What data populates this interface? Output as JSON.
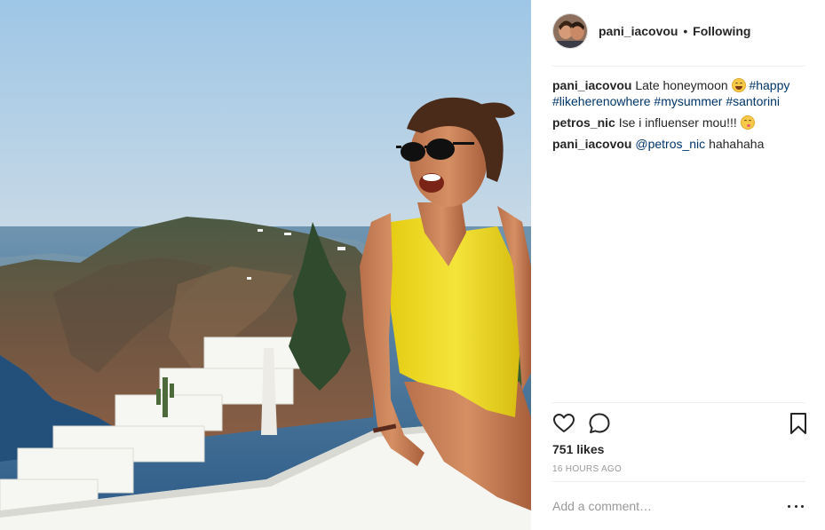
{
  "post": {
    "photo_alt": "Woman in yellow swimsuit and sunglasses sitting on a white wall above the Santorini caldera",
    "author": {
      "username": "pani_iacovou",
      "separator": "•",
      "follow_label": "Following"
    },
    "comments": [
      {
        "username": "pani_iacovou",
        "text": "Late honeymoon",
        "emoji": "laughing-emoji",
        "hashtags": [
          "#happy",
          "#likeherenowhere",
          "#mysummer",
          "#santorini"
        ]
      },
      {
        "username": "petros_nic",
        "text": "Ise i influenser mou!!!",
        "emoji": "wink-kiss-emoji"
      },
      {
        "username": "pani_iacovou",
        "mention": "@petros_nic",
        "text": "hahahaha"
      }
    ],
    "actions": {
      "like_icon": "heart-icon",
      "comment_icon": "comment-bubble-icon",
      "save_icon": "bookmark-icon"
    },
    "likes": "751 likes",
    "timestamp": "16 HOURS AGO",
    "add_comment": {
      "placeholder": "Add a comment…",
      "more_icon": "more-options-icon"
    }
  },
  "colors": {
    "link": "#003569",
    "muted": "#999999",
    "text": "#262626",
    "divider": "#efefef"
  }
}
